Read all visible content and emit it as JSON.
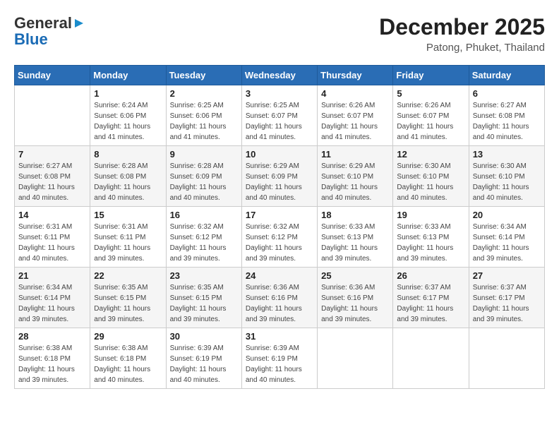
{
  "header": {
    "logo_general": "General",
    "logo_blue": "Blue",
    "month_year": "December 2025",
    "location": "Patong, Phuket, Thailand"
  },
  "days_of_week": [
    "Sunday",
    "Monday",
    "Tuesday",
    "Wednesday",
    "Thursday",
    "Friday",
    "Saturday"
  ],
  "weeks": [
    [
      {
        "day": "",
        "info": ""
      },
      {
        "day": "1",
        "info": "Sunrise: 6:24 AM\nSunset: 6:06 PM\nDaylight: 11 hours and 41 minutes."
      },
      {
        "day": "2",
        "info": "Sunrise: 6:25 AM\nSunset: 6:06 PM\nDaylight: 11 hours and 41 minutes."
      },
      {
        "day": "3",
        "info": "Sunrise: 6:25 AM\nSunset: 6:07 PM\nDaylight: 11 hours and 41 minutes."
      },
      {
        "day": "4",
        "info": "Sunrise: 6:26 AM\nSunset: 6:07 PM\nDaylight: 11 hours and 41 minutes."
      },
      {
        "day": "5",
        "info": "Sunrise: 6:26 AM\nSunset: 6:07 PM\nDaylight: 11 hours and 41 minutes."
      },
      {
        "day": "6",
        "info": "Sunrise: 6:27 AM\nSunset: 6:08 PM\nDaylight: 11 hours and 40 minutes."
      }
    ],
    [
      {
        "day": "7",
        "info": "Sunrise: 6:27 AM\nSunset: 6:08 PM\nDaylight: 11 hours and 40 minutes."
      },
      {
        "day": "8",
        "info": "Sunrise: 6:28 AM\nSunset: 6:08 PM\nDaylight: 11 hours and 40 minutes."
      },
      {
        "day": "9",
        "info": "Sunrise: 6:28 AM\nSunset: 6:09 PM\nDaylight: 11 hours and 40 minutes."
      },
      {
        "day": "10",
        "info": "Sunrise: 6:29 AM\nSunset: 6:09 PM\nDaylight: 11 hours and 40 minutes."
      },
      {
        "day": "11",
        "info": "Sunrise: 6:29 AM\nSunset: 6:10 PM\nDaylight: 11 hours and 40 minutes."
      },
      {
        "day": "12",
        "info": "Sunrise: 6:30 AM\nSunset: 6:10 PM\nDaylight: 11 hours and 40 minutes."
      },
      {
        "day": "13",
        "info": "Sunrise: 6:30 AM\nSunset: 6:10 PM\nDaylight: 11 hours and 40 minutes."
      }
    ],
    [
      {
        "day": "14",
        "info": "Sunrise: 6:31 AM\nSunset: 6:11 PM\nDaylight: 11 hours and 40 minutes."
      },
      {
        "day": "15",
        "info": "Sunrise: 6:31 AM\nSunset: 6:11 PM\nDaylight: 11 hours and 39 minutes."
      },
      {
        "day": "16",
        "info": "Sunrise: 6:32 AM\nSunset: 6:12 PM\nDaylight: 11 hours and 39 minutes."
      },
      {
        "day": "17",
        "info": "Sunrise: 6:32 AM\nSunset: 6:12 PM\nDaylight: 11 hours and 39 minutes."
      },
      {
        "day": "18",
        "info": "Sunrise: 6:33 AM\nSunset: 6:13 PM\nDaylight: 11 hours and 39 minutes."
      },
      {
        "day": "19",
        "info": "Sunrise: 6:33 AM\nSunset: 6:13 PM\nDaylight: 11 hours and 39 minutes."
      },
      {
        "day": "20",
        "info": "Sunrise: 6:34 AM\nSunset: 6:14 PM\nDaylight: 11 hours and 39 minutes."
      }
    ],
    [
      {
        "day": "21",
        "info": "Sunrise: 6:34 AM\nSunset: 6:14 PM\nDaylight: 11 hours and 39 minutes."
      },
      {
        "day": "22",
        "info": "Sunrise: 6:35 AM\nSunset: 6:15 PM\nDaylight: 11 hours and 39 minutes."
      },
      {
        "day": "23",
        "info": "Sunrise: 6:35 AM\nSunset: 6:15 PM\nDaylight: 11 hours and 39 minutes."
      },
      {
        "day": "24",
        "info": "Sunrise: 6:36 AM\nSunset: 6:16 PM\nDaylight: 11 hours and 39 minutes."
      },
      {
        "day": "25",
        "info": "Sunrise: 6:36 AM\nSunset: 6:16 PM\nDaylight: 11 hours and 39 minutes."
      },
      {
        "day": "26",
        "info": "Sunrise: 6:37 AM\nSunset: 6:17 PM\nDaylight: 11 hours and 39 minutes."
      },
      {
        "day": "27",
        "info": "Sunrise: 6:37 AM\nSunset: 6:17 PM\nDaylight: 11 hours and 39 minutes."
      }
    ],
    [
      {
        "day": "28",
        "info": "Sunrise: 6:38 AM\nSunset: 6:18 PM\nDaylight: 11 hours and 39 minutes."
      },
      {
        "day": "29",
        "info": "Sunrise: 6:38 AM\nSunset: 6:18 PM\nDaylight: 11 hours and 40 minutes."
      },
      {
        "day": "30",
        "info": "Sunrise: 6:39 AM\nSunset: 6:19 PM\nDaylight: 11 hours and 40 minutes."
      },
      {
        "day": "31",
        "info": "Sunrise: 6:39 AM\nSunset: 6:19 PM\nDaylight: 11 hours and 40 minutes."
      },
      {
        "day": "",
        "info": ""
      },
      {
        "day": "",
        "info": ""
      },
      {
        "day": "",
        "info": ""
      }
    ]
  ]
}
